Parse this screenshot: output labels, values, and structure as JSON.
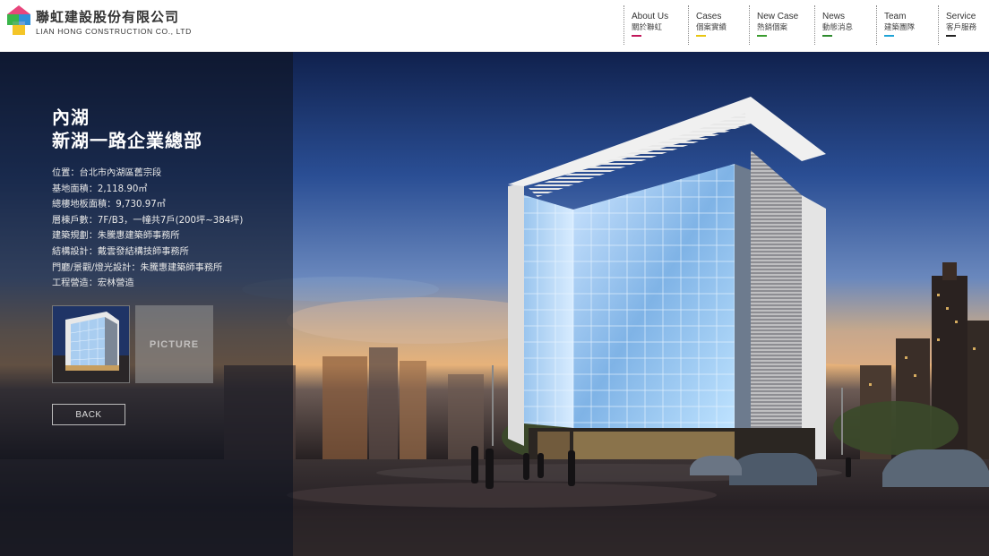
{
  "brand": {
    "name_zh": "聯虹建設股份有限公司",
    "name_en": "LIAN HONG CONSTRUCTION CO., LTD",
    "logo_colors": [
      "#e8467c",
      "#3ab54a",
      "#2f8fd8",
      "#f3c21b"
    ]
  },
  "nav": {
    "items": [
      {
        "en": "About Us",
        "zh": "關於聯虹",
        "color": "#c2185b"
      },
      {
        "en": "Cases",
        "zh": "個案實績",
        "color": "#e8c612"
      },
      {
        "en": "New Case",
        "zh": "熱銷個案",
        "color": "#3a9c2e"
      },
      {
        "en": "News",
        "zh": "動態消息",
        "color": "#2e8b2e"
      },
      {
        "en": "Team",
        "zh": "建築團隊",
        "color": "#1fa3d6"
      },
      {
        "en": "Service",
        "zh": "客戶服務",
        "color": "#222222"
      }
    ]
  },
  "project": {
    "title_line1": "內湖",
    "title_line2": "新湖一路企業總部",
    "specs": [
      "位置：台北市內湖區舊宗段",
      "基地面積：2,118.90㎡",
      "總樓地板面積：9,730.97㎡",
      "層棟戶數：7F/B3，一幢共7戶(200坪~384坪)",
      "建築規劃：朱騰惠建築師事務所",
      "結構設計：戴雲發結構技師事務所",
      "門廳/景觀/燈光設計：朱騰惠建築師事務所",
      "工程營造：宏林營造"
    ],
    "picture_label": "PICTURE",
    "back_label": "BACK"
  }
}
